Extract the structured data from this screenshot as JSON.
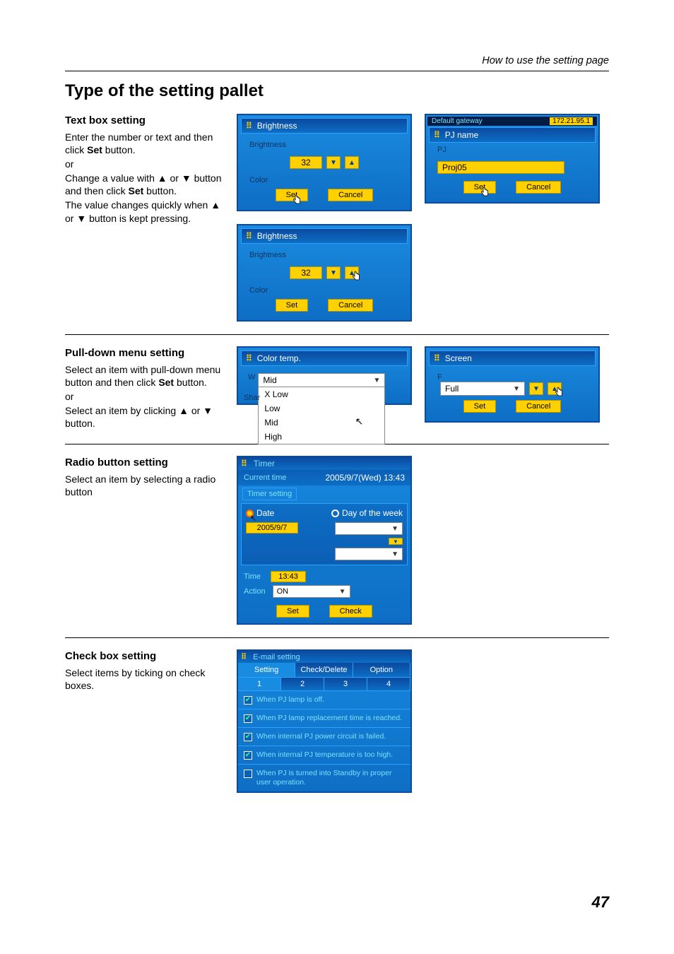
{
  "header_caption": "How to use the setting page",
  "h1": "Type of the setting pallet",
  "page_number": "47",
  "textbox": {
    "heading": "Text box setting",
    "p1_a": "Enter the number or text and then click ",
    "set_word": "Set",
    "p1_b": " button.",
    "or": "or",
    "p2_a": "Change a value with ▲ or ▼ button and then click ",
    "p2_b": " button.",
    "p3": "The value changes quickly when ▲ or ▼ button is kept pressing."
  },
  "brightness_panel": {
    "title": "Brightness",
    "value": "32",
    "set": "Set",
    "cancel": "Cancel",
    "label_brightness": "Brightness",
    "label_color": "Color"
  },
  "pj_panel": {
    "top_left": "Default gateway",
    "top_right": "172.21.95.1",
    "title": "PJ name",
    "value": "Proj05",
    "label_pj": "PJ",
    "set": "Set",
    "cancel": "Cancel"
  },
  "pulldown": {
    "heading": "Pull-down menu setting",
    "p1_a": "Select an item with pull-down menu button and then click ",
    "set_word": "Set",
    "p1_b": " button.",
    "or": "or",
    "p2": "Select an item by clicking ▲ or ▼ button."
  },
  "colortemp_panel": {
    "title": "Color temp.",
    "label_wb": "W",
    "label_shar": "Shar",
    "selected": "Mid",
    "options": [
      "X Low",
      "Low",
      "Mid",
      "High"
    ]
  },
  "screen_panel": {
    "title": "Screen",
    "label_f": "F",
    "selected": "Full",
    "set": "Set",
    "cancel": "Cancel"
  },
  "radio": {
    "heading": "Radio button setting",
    "p1": "Select an item by selecting a radio button"
  },
  "timer_panel": {
    "title": "Timer",
    "current_time_label": "Current time",
    "current_time_value": "2005/9/7(Wed) 13:43",
    "timer_setting_label": "Timer setting",
    "radio_date": "Date",
    "radio_dow": "Day of the week",
    "date_value": "2005/9/7",
    "time_label": "Time",
    "time_value": "13:43",
    "action_label": "Action",
    "action_value": "ON",
    "set": "Set",
    "check": "Check"
  },
  "checkbox": {
    "heading": "Check box setting",
    "p1": "Select items by ticking on check boxes."
  },
  "email_panel": {
    "title": "E-mail setting",
    "tabs": [
      "Setting",
      "Check/Delete",
      "Option"
    ],
    "num_tabs": [
      "1",
      "2",
      "3",
      "4"
    ],
    "items": [
      {
        "checked": true,
        "text": "When PJ lamp is off."
      },
      {
        "checked": true,
        "text": "When PJ lamp replacement time is reached."
      },
      {
        "checked": true,
        "text": "When internal PJ power circuit is failed."
      },
      {
        "checked": true,
        "text": "When internal PJ temperature is too high."
      },
      {
        "checked": false,
        "text": "When PJ is turned into Standby in proper user operation."
      }
    ]
  }
}
